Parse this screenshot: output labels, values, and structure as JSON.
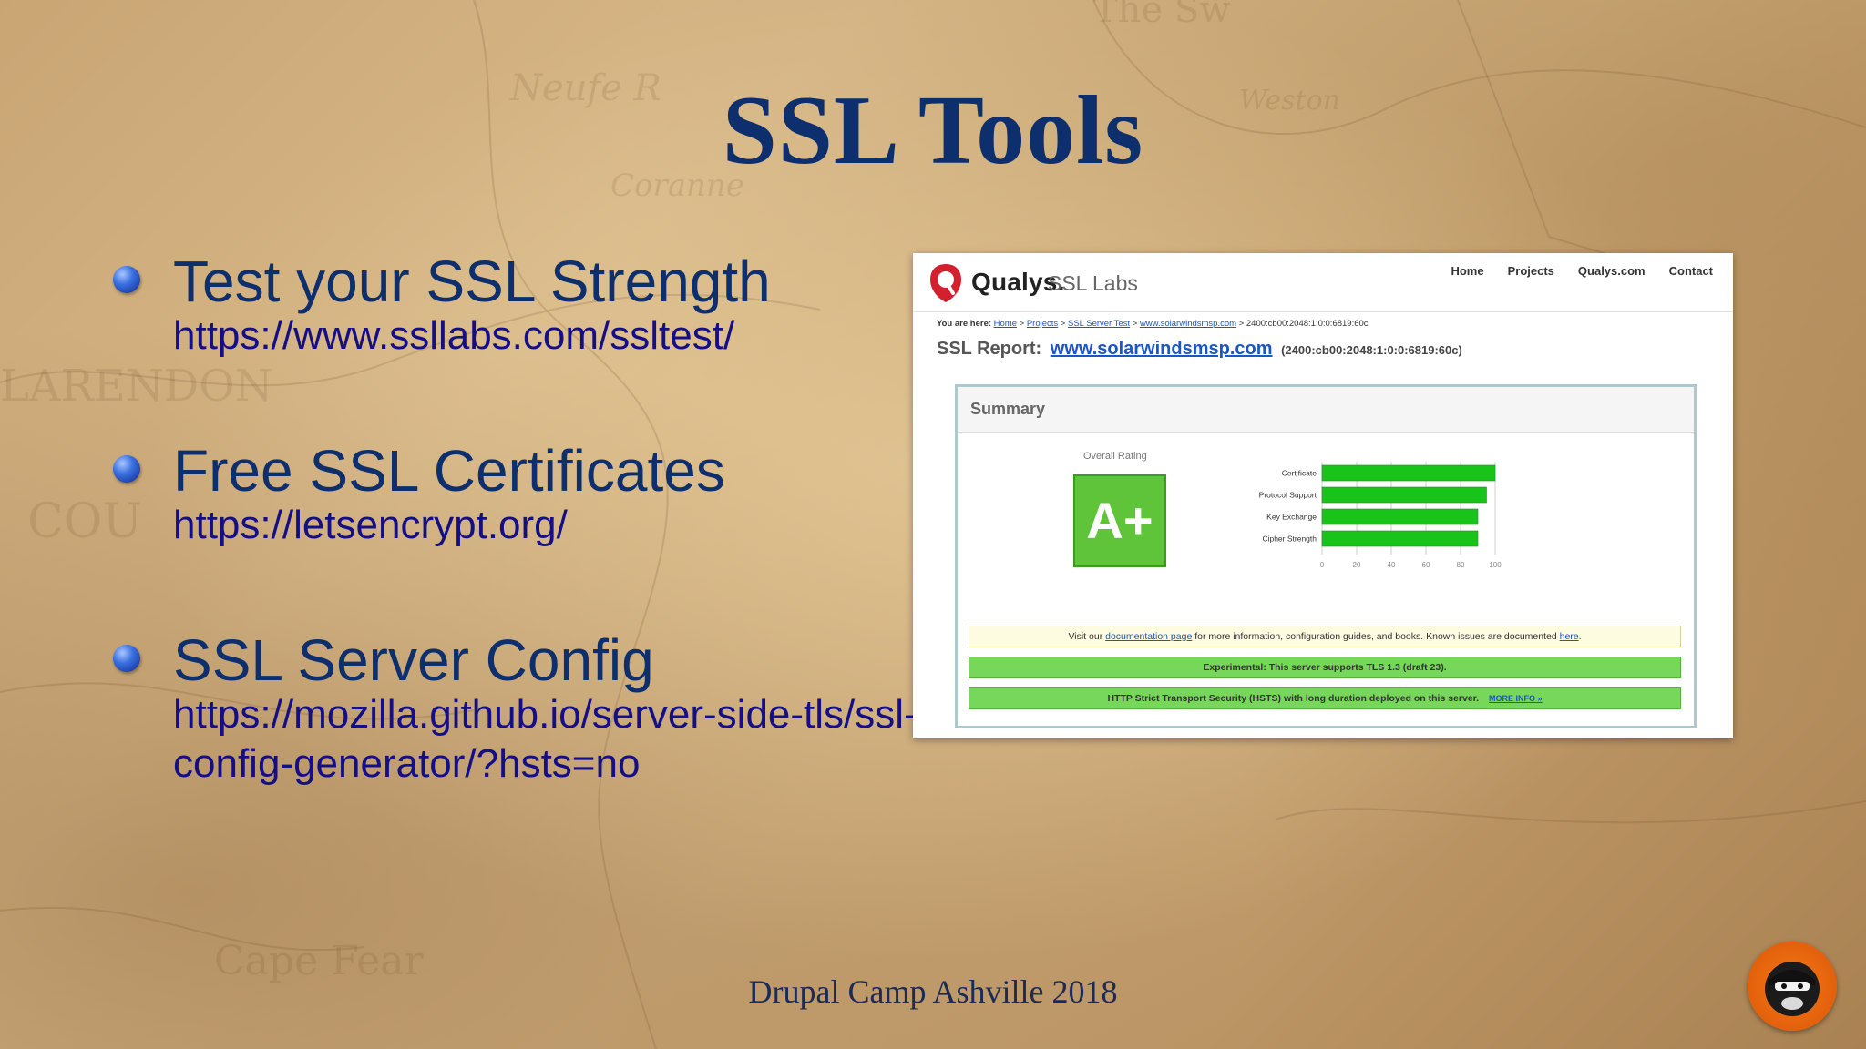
{
  "slide": {
    "title": "SSL Tools",
    "bullets": [
      {
        "heading": "Test your SSL Strength",
        "link": "https://www.ssllabs.com/ssltest/"
      },
      {
        "heading": "Free SSL Certificates",
        "link": "https://letsencrypt.org/"
      },
      {
        "heading": "SSL Server Config",
        "link": "https://mozilla.github.io/server-side-tls/ssl-config-generator/?hsts=no"
      }
    ],
    "footer": "Drupal Camp Ashville 2018"
  },
  "screenshot": {
    "brand": "Qualys.",
    "brand_sub": "SSL Labs",
    "nav": [
      "Home",
      "Projects",
      "Qualys.com",
      "Contact"
    ],
    "breadcrumb": {
      "prefix": "You are here:",
      "items": [
        "Home",
        "Projects",
        "SSL Server Test",
        "www.solarwindsmsp.com"
      ],
      "current": "2400:cb00:2048:1:0:0:6819:60c"
    },
    "report": {
      "label": "SSL Report:",
      "domain": "www.solarwindsmsp.com",
      "ip": "(2400:cb00:2048:1:0:0:6819:60c)"
    },
    "summary": {
      "title": "Summary",
      "overall_label": "Overall Rating",
      "grade": "A+",
      "messages": {
        "doc": {
          "pre": "Visit our",
          "link": "documentation page",
          "mid": "for more information, configuration guides, and books. Known issues are documented",
          "link2": "here",
          "post": "."
        },
        "tls13": "Experimental: This server supports TLS 1.3 (draft 23).",
        "hsts": "HTTP Strict Transport Security (HSTS) with long duration deployed on this server.",
        "hsts_more": "MORE INFO »"
      }
    }
  },
  "chart_data": {
    "type": "bar",
    "orientation": "horizontal",
    "categories": [
      "Certificate",
      "Protocol Support",
      "Key Exchange",
      "Cipher Strength"
    ],
    "values": [
      100,
      95,
      90,
      90
    ],
    "xlim": [
      0,
      100
    ],
    "xticks": [
      "0",
      "20",
      "40",
      "60",
      "80",
      "100"
    ],
    "bar_color": "#19c41a",
    "grid": true
  },
  "colors": {
    "title": "#0e2f6e",
    "link": "#140f86",
    "grade_green": "#5fc43a",
    "qualys_red": "#d3202f"
  }
}
